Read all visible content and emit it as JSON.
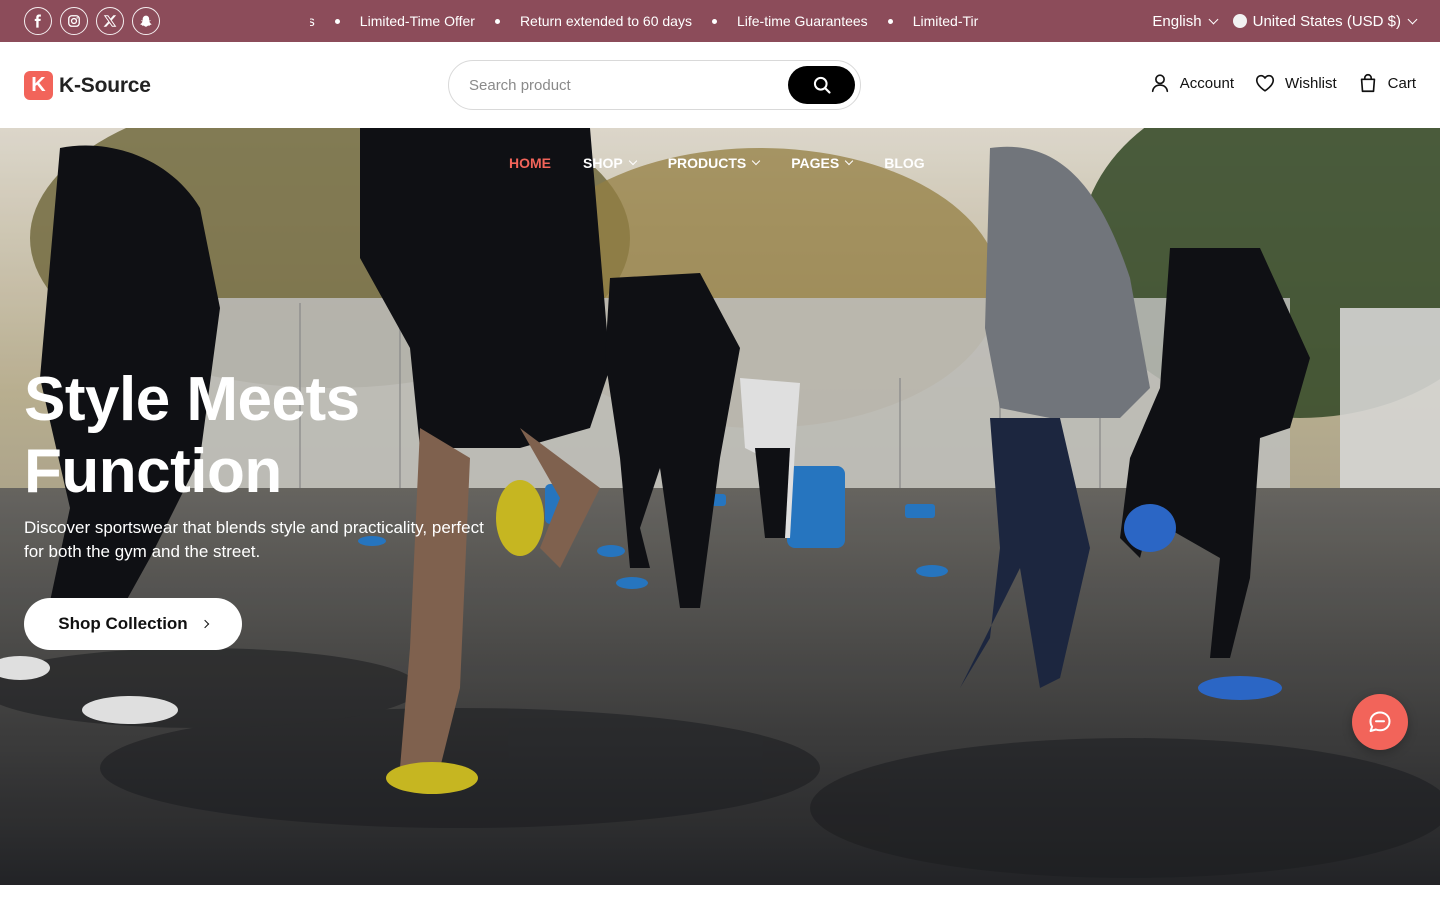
{
  "colors": {
    "topbar_bg": "#8c4c5a",
    "accent": "#f2645a",
    "search_button": "#000000"
  },
  "topbar": {
    "socials": [
      {
        "icon": "facebook-icon",
        "glyph": "f"
      },
      {
        "icon": "instagram-icon",
        "glyph": ""
      },
      {
        "icon": "x-icon",
        "glyph": "𝕏"
      },
      {
        "icon": "snapchat-icon",
        "glyph": ""
      }
    ],
    "ticker_items": [
      "es",
      "Limited-Time Offer",
      "Return extended to 60 days",
      "Life-time Guarantees",
      "Limited-Tir"
    ],
    "language": "English",
    "currency": "United States (USD $)"
  },
  "header": {
    "logo_mark": "K",
    "logo_text": "K-Source",
    "search_placeholder": "Search product",
    "actions": {
      "account": "Account",
      "wishlist": "Wishlist",
      "cart": "Cart"
    }
  },
  "nav": {
    "items": [
      "HOME",
      "SHOP",
      "PRODUCTS",
      "PAGES",
      "BLOG"
    ],
    "active": "HOME"
  },
  "hero": {
    "title_line1": "Style Meets",
    "title_line2": "Function",
    "subtitle": "Discover sportswear that blends style and practicality, perfect for both the gym and the street.",
    "cta_label": "Shop Collection"
  }
}
